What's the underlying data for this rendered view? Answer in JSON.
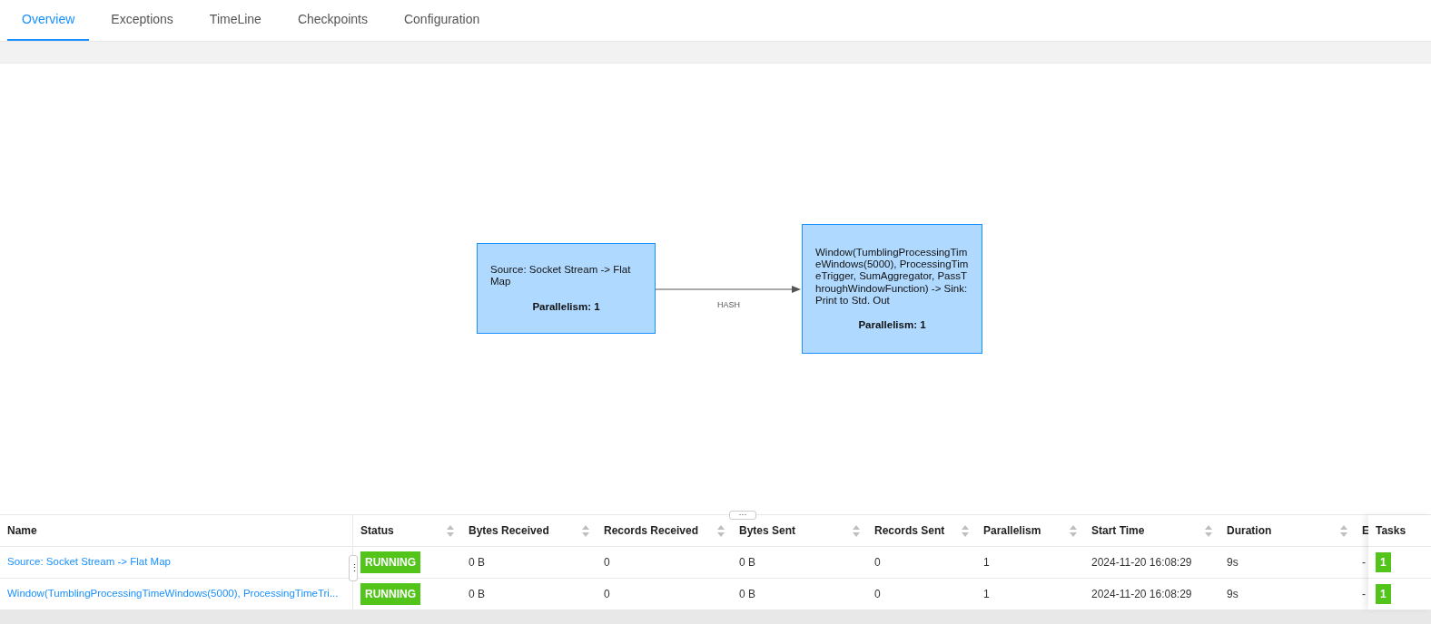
{
  "tabs": [
    {
      "label": "Overview",
      "selected": true
    },
    {
      "label": "Exceptions",
      "selected": false
    },
    {
      "label": "TimeLine",
      "selected": false
    },
    {
      "label": "Checkpoints",
      "selected": false
    },
    {
      "label": "Configuration",
      "selected": false
    }
  ],
  "graph": {
    "nodes": [
      {
        "description": "Source: Socket Stream -> Flat Map",
        "parallelism": "Parallelism: 1"
      },
      {
        "description": "Window(TumblingProcessingTimeWindows(5000), ProcessingTimeTrigger, SumAggregator, PassThroughWindowFunction) -> Sink: Print to Std. Out",
        "parallelism": "Parallelism: 1"
      }
    ],
    "edges": [
      {
        "label": "HASH"
      }
    ]
  },
  "resize_handle": "···",
  "column_handle": "⋮",
  "table": {
    "columns": [
      {
        "label": "Name",
        "sortable": false
      },
      {
        "label": "Status",
        "sortable": true
      },
      {
        "label": "Bytes Received",
        "sortable": true
      },
      {
        "label": "Records Received",
        "sortable": true
      },
      {
        "label": "Bytes Sent",
        "sortable": true
      },
      {
        "label": "Records Sent",
        "sortable": true
      },
      {
        "label": "Parallelism",
        "sortable": true
      },
      {
        "label": "Start Time",
        "sortable": true
      },
      {
        "label": "Duration",
        "sortable": true
      },
      {
        "label": "E"
      },
      {
        "label": "Tasks",
        "sortable": false
      }
    ],
    "rows": [
      {
        "name": "Source: Socket Stream -> Flat Map",
        "status": "RUNNING",
        "bytes_received": "0 B",
        "records_received": "0",
        "bytes_sent": "0 B",
        "records_sent": "0",
        "parallelism": "1",
        "start_time": "2024-11-20 16:08:29",
        "duration": "9s",
        "column_10": "-",
        "tasks": "1"
      },
      {
        "name": "Window(TumblingProcessingTimeWindows(5000), ProcessingTimeTri...",
        "status": "RUNNING",
        "bytes_received": "0 B",
        "records_received": "0",
        "bytes_sent": "0 B",
        "records_sent": "0",
        "parallelism": "1",
        "start_time": "2024-11-20 16:08:29",
        "duration": "9s",
        "column_10": "-",
        "tasks": "1"
      }
    ]
  }
}
